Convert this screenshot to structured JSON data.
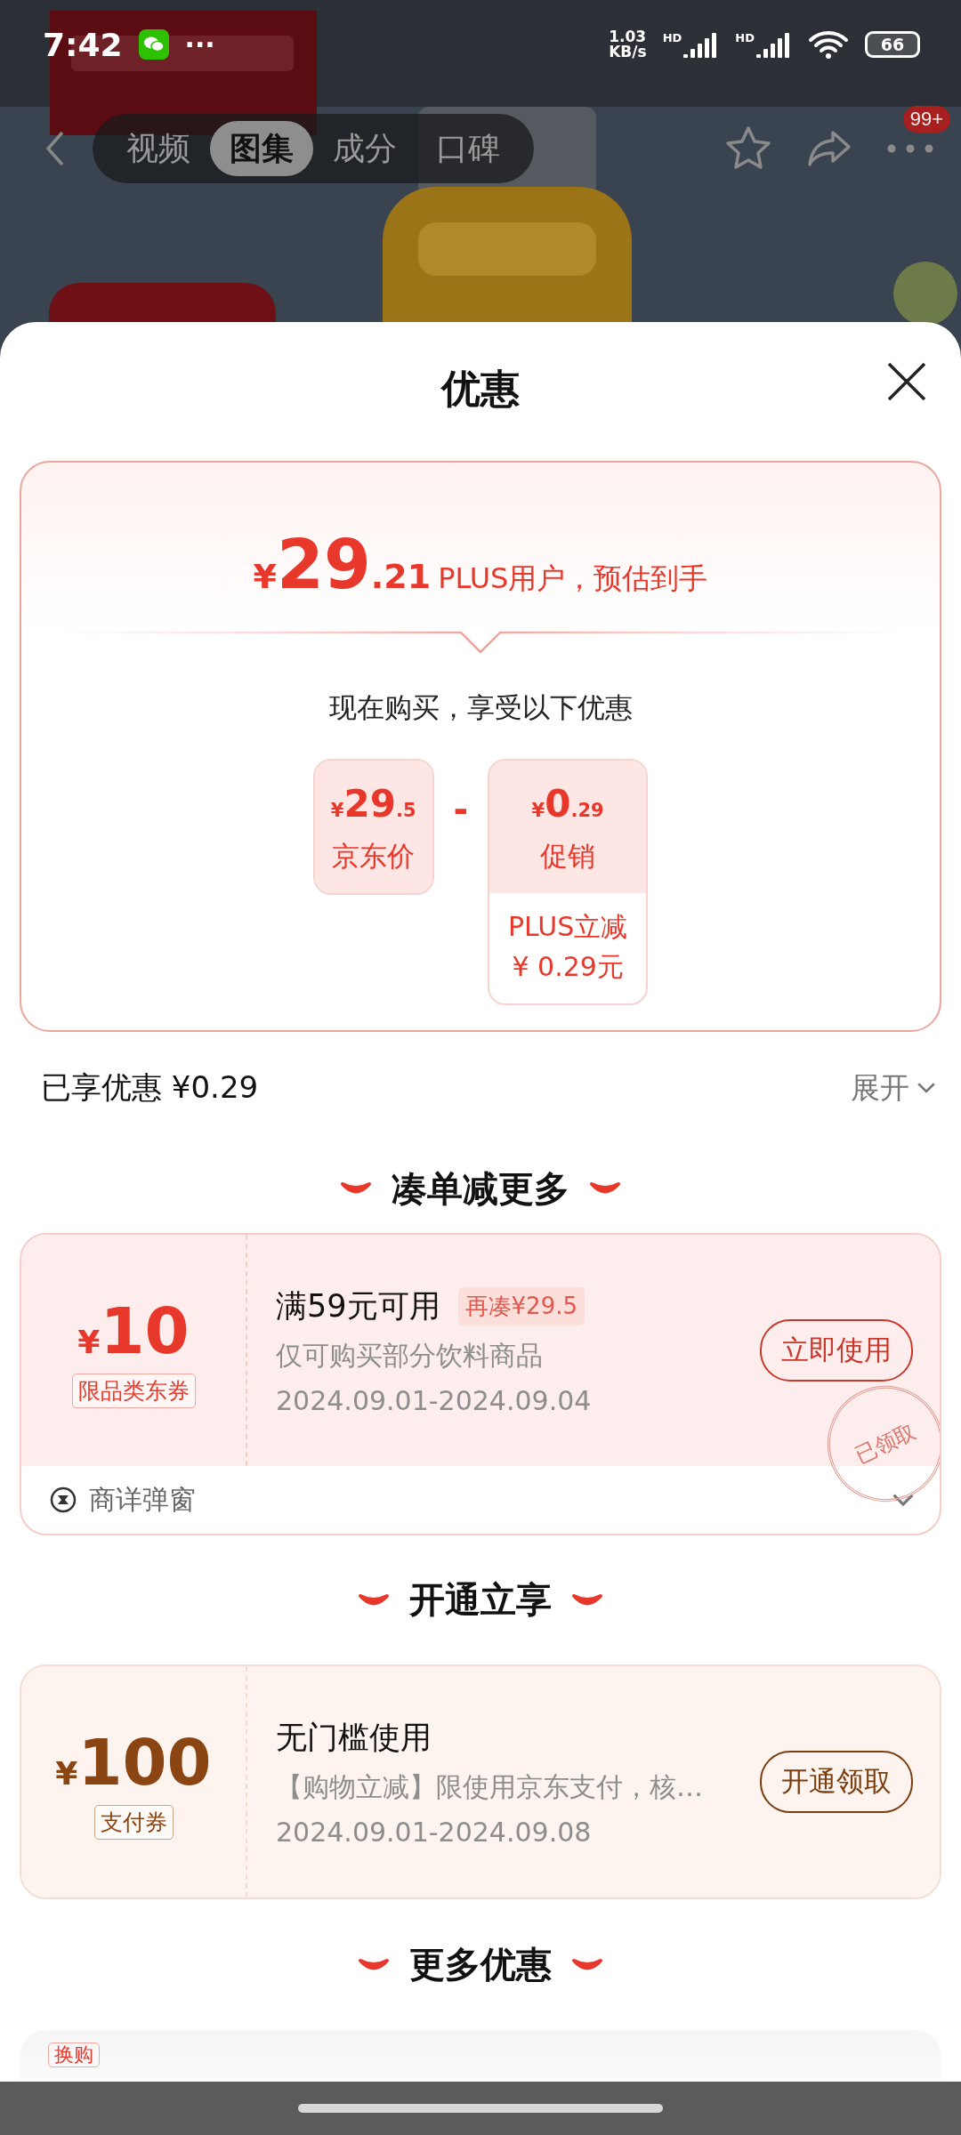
{
  "status_bar": {
    "time": "7:42",
    "more": "···",
    "net_speed": [
      "1.03",
      "KB/s"
    ],
    "sim_labels": [
      "HD",
      "HD"
    ],
    "battery": "66"
  },
  "nav": {
    "tabs": [
      {
        "label": "视频",
        "selected": false
      },
      {
        "label": "图集",
        "selected": true
      },
      {
        "label": "成分",
        "selected": false
      },
      {
        "label": "口碑",
        "selected": false
      }
    ],
    "badge": "99+"
  },
  "sheet": {
    "title": "优惠",
    "summary": {
      "currency": "¥",
      "price_integer": "29",
      "price_decimal": ".21",
      "price_note": "PLUS用户，预估到手",
      "subtitle": "现在购买，享受以下优惠",
      "operator": "-",
      "items": [
        {
          "currency": "¥",
          "integer": "29",
          "decimal": ".5",
          "label": "京东价"
        },
        {
          "currency": "¥",
          "integer": "0",
          "decimal": ".29",
          "label": "促销",
          "details": [
            "PLUS立减",
            "¥ 0.29元"
          ]
        }
      ]
    },
    "enjoyed": {
      "label": "已享优惠 ¥0.29",
      "toggle": "展开"
    },
    "sections": [
      {
        "heading": "凑单减更多",
        "coupons": [
          {
            "kind": "store",
            "currency": "¥",
            "amount": "10",
            "tag": "限品类东券",
            "title": "满59元可用",
            "extra": "再凑¥29.5",
            "description": "仅可购买部分饮料商品",
            "dates": "2024.09.01-2024.09.04",
            "button": "立即使用",
            "stamp": "已领取",
            "footer": "商详弹窗"
          }
        ]
      },
      {
        "heading": "开通立享",
        "coupons": [
          {
            "kind": "payment",
            "currency": "¥",
            "amount": "100",
            "tag": "支付券",
            "title": "无门槛使用",
            "description": "【购物立减】限使用京东支付，核…",
            "dates": "2024.09.01-2024.09.08",
            "button": "开通领取"
          }
        ]
      },
      {
        "heading": "更多优惠",
        "cards": [
          {
            "tag": "换购"
          }
        ]
      }
    ]
  }
}
